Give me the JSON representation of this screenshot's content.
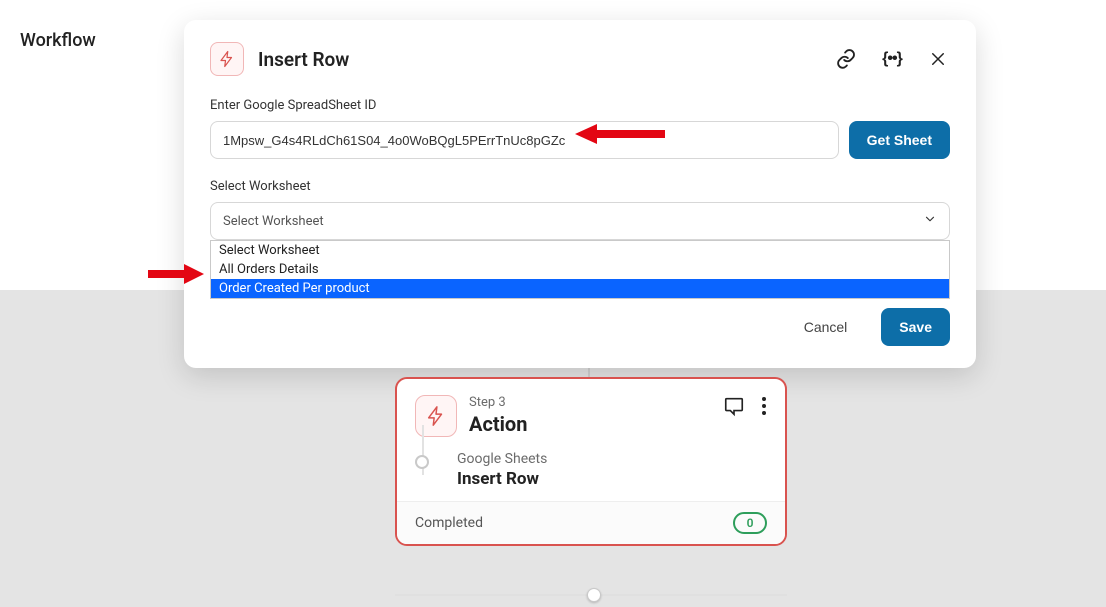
{
  "page": {
    "section_label": "Workflow"
  },
  "modal": {
    "title": "Insert Row",
    "spreadsheet_label": "Enter Google SpreadSheet ID",
    "spreadsheet_value": "1Mpsw_G4s4RLdCh61S04_4o0WoBQgL5PErrTnUc8pGZc",
    "get_sheet_label": "Get Sheet",
    "worksheet_label": "Select Worksheet",
    "worksheet_placeholder": "Select Worksheet",
    "worksheet_options": [
      "Select Worksheet",
      "All Orders Details",
      "Order Created Per product"
    ],
    "cancel_label": "Cancel",
    "save_label": "Save"
  },
  "flow_card": {
    "step_label": "Step 3",
    "step_title": "Action",
    "service": "Google Sheets",
    "action": "Insert Row",
    "status": "Completed",
    "count": "0"
  }
}
